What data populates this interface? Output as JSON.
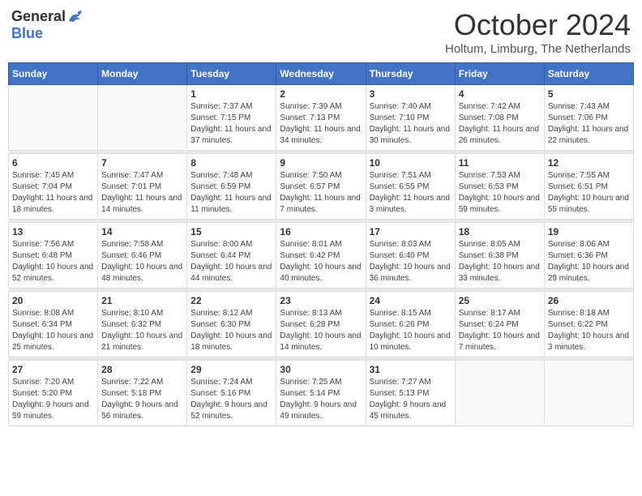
{
  "header": {
    "logo_general": "General",
    "logo_blue": "Blue",
    "month_title": "October 2024",
    "subtitle": "Holtum, Limburg, The Netherlands"
  },
  "days_of_week": [
    "Sunday",
    "Monday",
    "Tuesday",
    "Wednesday",
    "Thursday",
    "Friday",
    "Saturday"
  ],
  "weeks": [
    {
      "days": [
        {
          "num": "",
          "info": ""
        },
        {
          "num": "",
          "info": ""
        },
        {
          "num": "1",
          "info": "Sunrise: 7:37 AM\nSunset: 7:15 PM\nDaylight: 11 hours and 37 minutes."
        },
        {
          "num": "2",
          "info": "Sunrise: 7:39 AM\nSunset: 7:13 PM\nDaylight: 11 hours and 34 minutes."
        },
        {
          "num": "3",
          "info": "Sunrise: 7:40 AM\nSunset: 7:10 PM\nDaylight: 11 hours and 30 minutes."
        },
        {
          "num": "4",
          "info": "Sunrise: 7:42 AM\nSunset: 7:08 PM\nDaylight: 11 hours and 26 minutes."
        },
        {
          "num": "5",
          "info": "Sunrise: 7:43 AM\nSunset: 7:06 PM\nDaylight: 11 hours and 22 minutes."
        }
      ]
    },
    {
      "days": [
        {
          "num": "6",
          "info": "Sunrise: 7:45 AM\nSunset: 7:04 PM\nDaylight: 11 hours and 18 minutes."
        },
        {
          "num": "7",
          "info": "Sunrise: 7:47 AM\nSunset: 7:01 PM\nDaylight: 11 hours and 14 minutes."
        },
        {
          "num": "8",
          "info": "Sunrise: 7:48 AM\nSunset: 6:59 PM\nDaylight: 11 hours and 11 minutes."
        },
        {
          "num": "9",
          "info": "Sunrise: 7:50 AM\nSunset: 6:57 PM\nDaylight: 11 hours and 7 minutes."
        },
        {
          "num": "10",
          "info": "Sunrise: 7:51 AM\nSunset: 6:55 PM\nDaylight: 11 hours and 3 minutes."
        },
        {
          "num": "11",
          "info": "Sunrise: 7:53 AM\nSunset: 6:53 PM\nDaylight: 10 hours and 59 minutes."
        },
        {
          "num": "12",
          "info": "Sunrise: 7:55 AM\nSunset: 6:51 PM\nDaylight: 10 hours and 55 minutes."
        }
      ]
    },
    {
      "days": [
        {
          "num": "13",
          "info": "Sunrise: 7:56 AM\nSunset: 6:48 PM\nDaylight: 10 hours and 52 minutes."
        },
        {
          "num": "14",
          "info": "Sunrise: 7:58 AM\nSunset: 6:46 PM\nDaylight: 10 hours and 48 minutes."
        },
        {
          "num": "15",
          "info": "Sunrise: 8:00 AM\nSunset: 6:44 PM\nDaylight: 10 hours and 44 minutes."
        },
        {
          "num": "16",
          "info": "Sunrise: 8:01 AM\nSunset: 6:42 PM\nDaylight: 10 hours and 40 minutes."
        },
        {
          "num": "17",
          "info": "Sunrise: 8:03 AM\nSunset: 6:40 PM\nDaylight: 10 hours and 36 minutes."
        },
        {
          "num": "18",
          "info": "Sunrise: 8:05 AM\nSunset: 6:38 PM\nDaylight: 10 hours and 33 minutes."
        },
        {
          "num": "19",
          "info": "Sunrise: 8:06 AM\nSunset: 6:36 PM\nDaylight: 10 hours and 29 minutes."
        }
      ]
    },
    {
      "days": [
        {
          "num": "20",
          "info": "Sunrise: 8:08 AM\nSunset: 6:34 PM\nDaylight: 10 hours and 25 minutes."
        },
        {
          "num": "21",
          "info": "Sunrise: 8:10 AM\nSunset: 6:32 PM\nDaylight: 10 hours and 21 minutes."
        },
        {
          "num": "22",
          "info": "Sunrise: 8:12 AM\nSunset: 6:30 PM\nDaylight: 10 hours and 18 minutes."
        },
        {
          "num": "23",
          "info": "Sunrise: 8:13 AM\nSunset: 6:28 PM\nDaylight: 10 hours and 14 minutes."
        },
        {
          "num": "24",
          "info": "Sunrise: 8:15 AM\nSunset: 6:26 PM\nDaylight: 10 hours and 10 minutes."
        },
        {
          "num": "25",
          "info": "Sunrise: 8:17 AM\nSunset: 6:24 PM\nDaylight: 10 hours and 7 minutes."
        },
        {
          "num": "26",
          "info": "Sunrise: 8:18 AM\nSunset: 6:22 PM\nDaylight: 10 hours and 3 minutes."
        }
      ]
    },
    {
      "days": [
        {
          "num": "27",
          "info": "Sunrise: 7:20 AM\nSunset: 5:20 PM\nDaylight: 9 hours and 59 minutes."
        },
        {
          "num": "28",
          "info": "Sunrise: 7:22 AM\nSunset: 5:18 PM\nDaylight: 9 hours and 56 minutes."
        },
        {
          "num": "29",
          "info": "Sunrise: 7:24 AM\nSunset: 5:16 PM\nDaylight: 9 hours and 52 minutes."
        },
        {
          "num": "30",
          "info": "Sunrise: 7:25 AM\nSunset: 5:14 PM\nDaylight: 9 hours and 49 minutes."
        },
        {
          "num": "31",
          "info": "Sunrise: 7:27 AM\nSunset: 5:13 PM\nDaylight: 9 hours and 45 minutes."
        },
        {
          "num": "",
          "info": ""
        },
        {
          "num": "",
          "info": ""
        }
      ]
    }
  ]
}
